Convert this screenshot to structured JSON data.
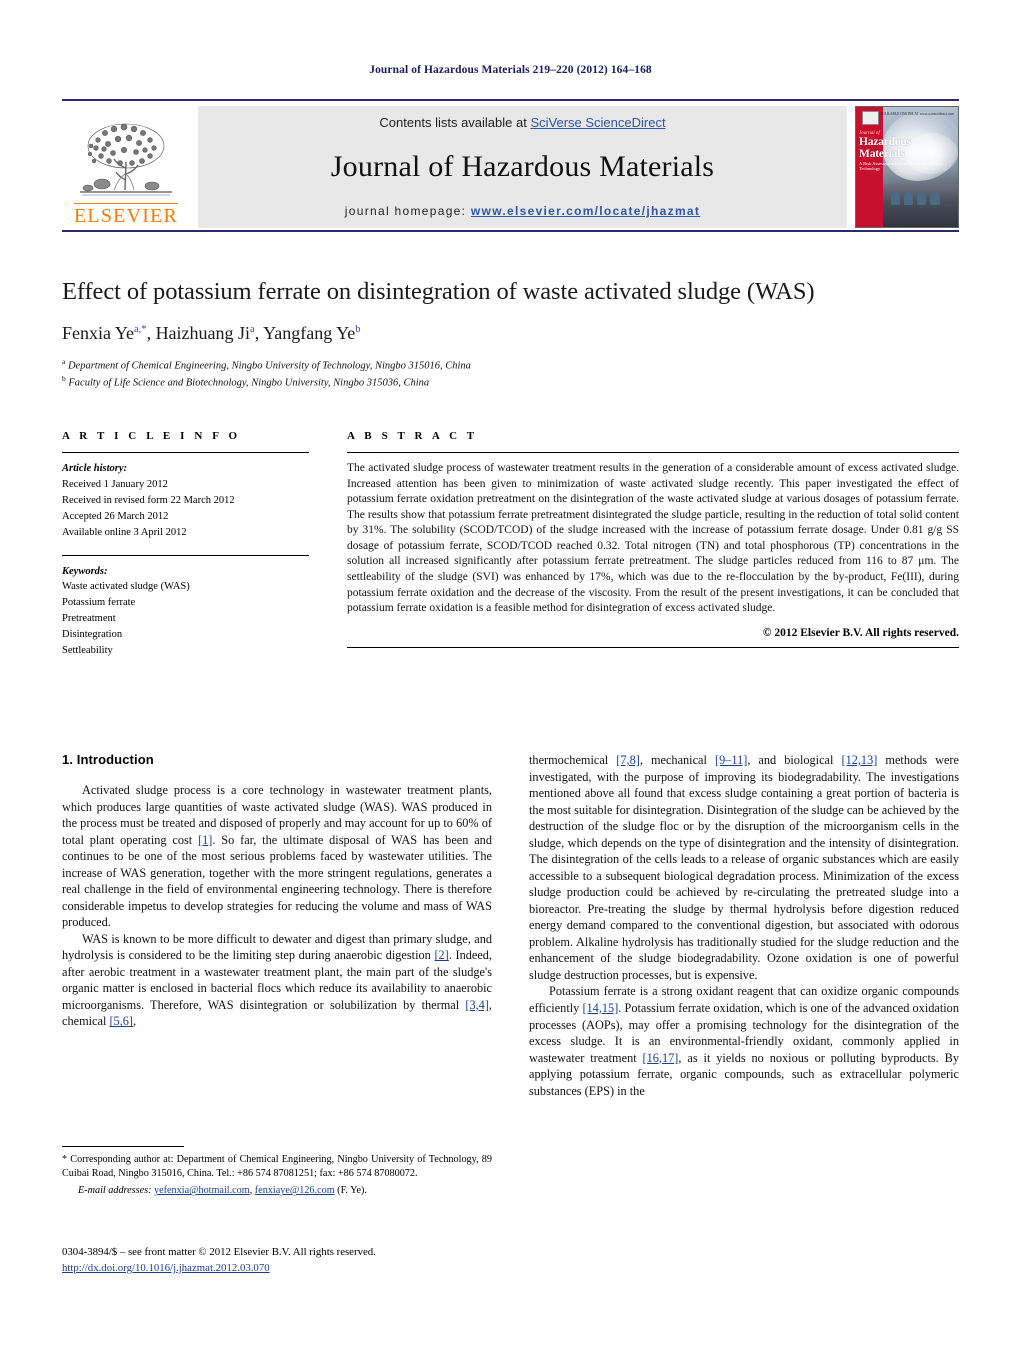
{
  "running_head": "Journal of Hazardous Materials 219–220 (2012) 164–168",
  "masthead": {
    "contents_prefix": "Contents lists available at ",
    "contents_link": "SciVerse ScienceDirect",
    "journal_name": "Journal of Hazardous Materials",
    "homepage_prefix": "journal homepage: ",
    "homepage_url": "www.elsevier.com/locate/jhazmat",
    "publisher_wordmark": "ELSEVIER",
    "cover": {
      "overline": "Journal of",
      "title": "Hazardous Materials",
      "subtitle": "A Risk Assessment Journal for Environmental Technology",
      "corner_note": "AVAILABLE ONLINE AT\nwww.sciencedirect.com"
    }
  },
  "article": {
    "title": "Effect of potassium ferrate on disintegration of waste activated sludge (WAS)",
    "authors": [
      {
        "name": "Fenxia Ye",
        "marks": "a,*"
      },
      {
        "name": "Haizhuang Ji",
        "marks": "a"
      },
      {
        "name": "Yangfang Ye",
        "marks": "b"
      }
    ],
    "authors_line": "Fenxia Ye, Haizhuang Ji, Yangfang Ye",
    "affiliations": [
      {
        "mark": "a",
        "text": "Department of Chemical Engineering, Ningbo University of Technology, Ningbo 315016, China"
      },
      {
        "mark": "b",
        "text": "Faculty of Life Science and Biotechnology, Ningbo University, Ningbo 315036, China"
      }
    ]
  },
  "article_info": {
    "label": "A R T I C L E   I N F O",
    "history_head": "Article history:",
    "history": [
      "Received 1 January 2012",
      "Received in revised form 22 March 2012",
      "Accepted 26 March 2012",
      "Available online 3 April 2012"
    ],
    "keywords_head": "Keywords:",
    "keywords": [
      "Waste activated sludge (WAS)",
      "Potassium ferrate",
      "Pretreatment",
      "Disintegration",
      "Settleability"
    ]
  },
  "abstract": {
    "label": "A B S T R A C T",
    "text": "The activated sludge process of wastewater treatment results in the generation of a considerable amount of excess activated sludge. Increased attention has been given to minimization of waste activated sludge recently. This paper investigated the effect of potassium ferrate oxidation pretreatment on the disintegration of the waste activated sludge at various dosages of potassium ferrate. The results show that potassium ferrate pretreatment disintegrated the sludge particle, resulting in the reduction of total solid content by 31%. The solubility (SCOD/TCOD) of the sludge increased with the increase of potassium ferrate dosage. Under 0.81 g/g SS dosage of potassium ferrate, SCOD/TCOD reached 0.32. Total nitrogen (TN) and total phosphorous (TP) concentrations in the solution all increased significantly after potassium ferrate pretreatment. The sludge particles reduced from 116 to 87 μm. The settleability of the sludge (SVI) was enhanced by 17%, which was due to the re-flocculation by the by-product, Fe(III), during potassium ferrate oxidation and the decrease of the viscosity. From the result of the present investigations, it can be concluded that potassium ferrate oxidation is a feasible method for disintegration of excess activated sludge.",
    "copyright": "© 2012 Elsevier B.V. All rights reserved."
  },
  "body": {
    "section_heading": "1.  Introduction",
    "left_paragraphs": [
      {
        "parts": [
          {
            "t": "Activated sludge process is a core technology in wastewater treatment plants, which produces large quantities of waste activated sludge (WAS). WAS produced in the process must be treated and disposed of properly and may account for up to 60% of total plant operating cost "
          },
          {
            "t": "[1]",
            "ref": true
          },
          {
            "t": ". So far, the ultimate disposal of WAS has been and continues to be one of the most serious problems faced by wastewater utilities. The increase of WAS generation, together with the more stringent regulations, generates a real challenge in the field of environmental engineering technology. There is therefore considerable impetus to develop strategies for reducing the volume and mass of WAS produced."
          }
        ]
      },
      {
        "parts": [
          {
            "t": "WAS is known to be more difficult to dewater and digest than primary sludge, and hydrolysis is considered to be the limiting step during anaerobic digestion "
          },
          {
            "t": "[2]",
            "ref": true
          },
          {
            "t": ". Indeed, after aerobic treatment in a wastewater treatment plant, the main part of the sludge's organic matter is enclosed in bacterial flocs which reduce its availability to anaerobic microorganisms. Therefore, WAS disintegration or solubilization by thermal "
          },
          {
            "t": "[3,4]",
            "ref": true
          },
          {
            "t": ", chemical "
          },
          {
            "t": "[5,6]",
            "ref": true
          },
          {
            "t": ","
          }
        ]
      }
    ],
    "right_paragraphs": [
      {
        "continued": true,
        "parts": [
          {
            "t": "thermochemical "
          },
          {
            "t": "[7,8]",
            "ref": true
          },
          {
            "t": ", mechanical "
          },
          {
            "t": "[9–11]",
            "ref": true
          },
          {
            "t": ", and biological "
          },
          {
            "t": "[12,13]",
            "ref": true
          },
          {
            "t": " methods were investigated, with the purpose of improving its biodegradability. The investigations mentioned above all found that excess sludge containing a great portion of bacteria is the most suitable for disintegration. Disintegration of the sludge can be achieved by the destruction of the sludge floc or by the disruption of the microorganism cells in the sludge, which depends on the type of disintegration and the intensity of disintegration. The disintegration of the cells leads to a release of organic substances which are easily accessible to a subsequent biological degradation process. Minimization of the excess sludge production could be achieved by re-circulating the pretreated sludge into a bioreactor. Pre-treating the sludge by thermal hydrolysis before digestion reduced energy demand compared to the conventional digestion, but associated with odorous problem. Alkaline hydrolysis has traditionally studied for the sludge reduction and the enhancement of the sludge biodegradability. Ozone oxidation is one of powerful sludge destruction processes, but is expensive."
          }
        ]
      },
      {
        "continued": false,
        "parts": [
          {
            "t": "Potassium ferrate is a strong oxidant reagent that can oxidize organic compounds efficiently "
          },
          {
            "t": "[14,15]",
            "ref": true
          },
          {
            "t": ". Potassium ferrate oxidation, which is one of the advanced oxidation processes (AOPs), may offer a promising technology for the disintegration of the excess sludge. It is an environmental-friendly oxidant, commonly applied in wastewater treatment "
          },
          {
            "t": "[16,17]",
            "ref": true
          },
          {
            "t": ", as it yields no noxious or polluting byproducts. By applying potassium ferrate, organic compounds, such as extracellular polymeric substances (EPS) in the"
          }
        ]
      }
    ]
  },
  "footnote": {
    "corresponding": "* Corresponding author at: Department of Chemical Engineering, Ningbo University of Technology, 89 Cuibai Road, Ningbo 315016, China. Tel.: +86 574 87081251; fax: +86 574 87080072.",
    "email_label": "E-mail addresses:",
    "email_1": "yefenxia@hotmail.com",
    "email_2": "fenxiaye@126.com",
    "email_suffix": "(F. Ye)."
  },
  "imprint": {
    "issn_line": "0304-3894/$ – see front matter © 2012 Elsevier B.V. All rights reserved.",
    "doi": "http://dx.doi.org/10.1016/j.jhazmat.2012.03.070"
  },
  "colors": {
    "header_blue": "#1b1b5e",
    "rule_blue": "#2b2b6b",
    "link_blue": "#2f55a4",
    "ref_blue": "#1b3f8f",
    "elsevier_orange": "#f07c00",
    "cover_red": "#c8102e",
    "panel_grey": "#e8e8e8"
  }
}
